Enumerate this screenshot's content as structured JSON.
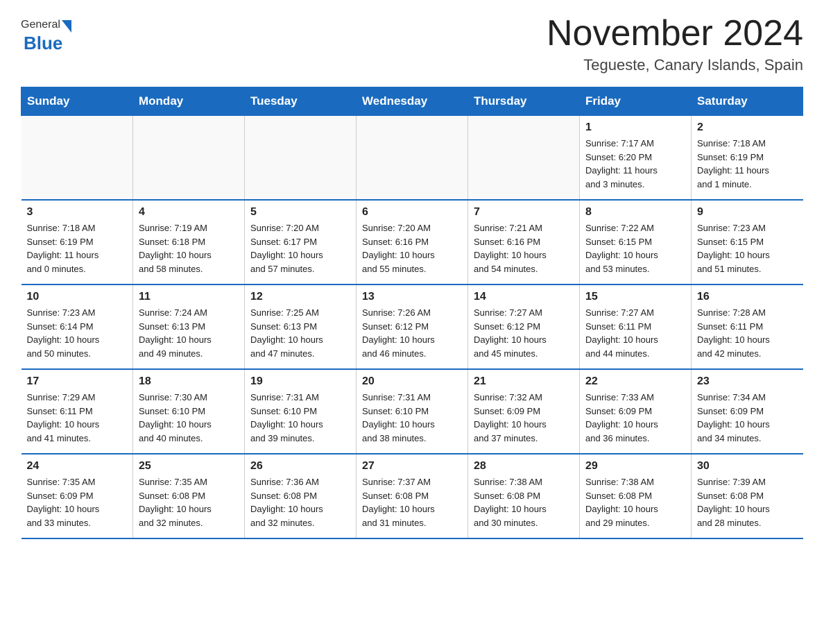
{
  "logo": {
    "general": "General",
    "blue": "Blue"
  },
  "title": "November 2024",
  "subtitle": "Tegueste, Canary Islands, Spain",
  "days_of_week": [
    "Sunday",
    "Monday",
    "Tuesday",
    "Wednesday",
    "Thursday",
    "Friday",
    "Saturday"
  ],
  "weeks": [
    [
      {
        "day": "",
        "info": ""
      },
      {
        "day": "",
        "info": ""
      },
      {
        "day": "",
        "info": ""
      },
      {
        "day": "",
        "info": ""
      },
      {
        "day": "",
        "info": ""
      },
      {
        "day": "1",
        "info": "Sunrise: 7:17 AM\nSunset: 6:20 PM\nDaylight: 11 hours\nand 3 minutes."
      },
      {
        "day": "2",
        "info": "Sunrise: 7:18 AM\nSunset: 6:19 PM\nDaylight: 11 hours\nand 1 minute."
      }
    ],
    [
      {
        "day": "3",
        "info": "Sunrise: 7:18 AM\nSunset: 6:19 PM\nDaylight: 11 hours\nand 0 minutes."
      },
      {
        "day": "4",
        "info": "Sunrise: 7:19 AM\nSunset: 6:18 PM\nDaylight: 10 hours\nand 58 minutes."
      },
      {
        "day": "5",
        "info": "Sunrise: 7:20 AM\nSunset: 6:17 PM\nDaylight: 10 hours\nand 57 minutes."
      },
      {
        "day": "6",
        "info": "Sunrise: 7:20 AM\nSunset: 6:16 PM\nDaylight: 10 hours\nand 55 minutes."
      },
      {
        "day": "7",
        "info": "Sunrise: 7:21 AM\nSunset: 6:16 PM\nDaylight: 10 hours\nand 54 minutes."
      },
      {
        "day": "8",
        "info": "Sunrise: 7:22 AM\nSunset: 6:15 PM\nDaylight: 10 hours\nand 53 minutes."
      },
      {
        "day": "9",
        "info": "Sunrise: 7:23 AM\nSunset: 6:15 PM\nDaylight: 10 hours\nand 51 minutes."
      }
    ],
    [
      {
        "day": "10",
        "info": "Sunrise: 7:23 AM\nSunset: 6:14 PM\nDaylight: 10 hours\nand 50 minutes."
      },
      {
        "day": "11",
        "info": "Sunrise: 7:24 AM\nSunset: 6:13 PM\nDaylight: 10 hours\nand 49 minutes."
      },
      {
        "day": "12",
        "info": "Sunrise: 7:25 AM\nSunset: 6:13 PM\nDaylight: 10 hours\nand 47 minutes."
      },
      {
        "day": "13",
        "info": "Sunrise: 7:26 AM\nSunset: 6:12 PM\nDaylight: 10 hours\nand 46 minutes."
      },
      {
        "day": "14",
        "info": "Sunrise: 7:27 AM\nSunset: 6:12 PM\nDaylight: 10 hours\nand 45 minutes."
      },
      {
        "day": "15",
        "info": "Sunrise: 7:27 AM\nSunset: 6:11 PM\nDaylight: 10 hours\nand 44 minutes."
      },
      {
        "day": "16",
        "info": "Sunrise: 7:28 AM\nSunset: 6:11 PM\nDaylight: 10 hours\nand 42 minutes."
      }
    ],
    [
      {
        "day": "17",
        "info": "Sunrise: 7:29 AM\nSunset: 6:11 PM\nDaylight: 10 hours\nand 41 minutes."
      },
      {
        "day": "18",
        "info": "Sunrise: 7:30 AM\nSunset: 6:10 PM\nDaylight: 10 hours\nand 40 minutes."
      },
      {
        "day": "19",
        "info": "Sunrise: 7:31 AM\nSunset: 6:10 PM\nDaylight: 10 hours\nand 39 minutes."
      },
      {
        "day": "20",
        "info": "Sunrise: 7:31 AM\nSunset: 6:10 PM\nDaylight: 10 hours\nand 38 minutes."
      },
      {
        "day": "21",
        "info": "Sunrise: 7:32 AM\nSunset: 6:09 PM\nDaylight: 10 hours\nand 37 minutes."
      },
      {
        "day": "22",
        "info": "Sunrise: 7:33 AM\nSunset: 6:09 PM\nDaylight: 10 hours\nand 36 minutes."
      },
      {
        "day": "23",
        "info": "Sunrise: 7:34 AM\nSunset: 6:09 PM\nDaylight: 10 hours\nand 34 minutes."
      }
    ],
    [
      {
        "day": "24",
        "info": "Sunrise: 7:35 AM\nSunset: 6:09 PM\nDaylight: 10 hours\nand 33 minutes."
      },
      {
        "day": "25",
        "info": "Sunrise: 7:35 AM\nSunset: 6:08 PM\nDaylight: 10 hours\nand 32 minutes."
      },
      {
        "day": "26",
        "info": "Sunrise: 7:36 AM\nSunset: 6:08 PM\nDaylight: 10 hours\nand 32 minutes."
      },
      {
        "day": "27",
        "info": "Sunrise: 7:37 AM\nSunset: 6:08 PM\nDaylight: 10 hours\nand 31 minutes."
      },
      {
        "day": "28",
        "info": "Sunrise: 7:38 AM\nSunset: 6:08 PM\nDaylight: 10 hours\nand 30 minutes."
      },
      {
        "day": "29",
        "info": "Sunrise: 7:38 AM\nSunset: 6:08 PM\nDaylight: 10 hours\nand 29 minutes."
      },
      {
        "day": "30",
        "info": "Sunrise: 7:39 AM\nSunset: 6:08 PM\nDaylight: 10 hours\nand 28 minutes."
      }
    ]
  ]
}
